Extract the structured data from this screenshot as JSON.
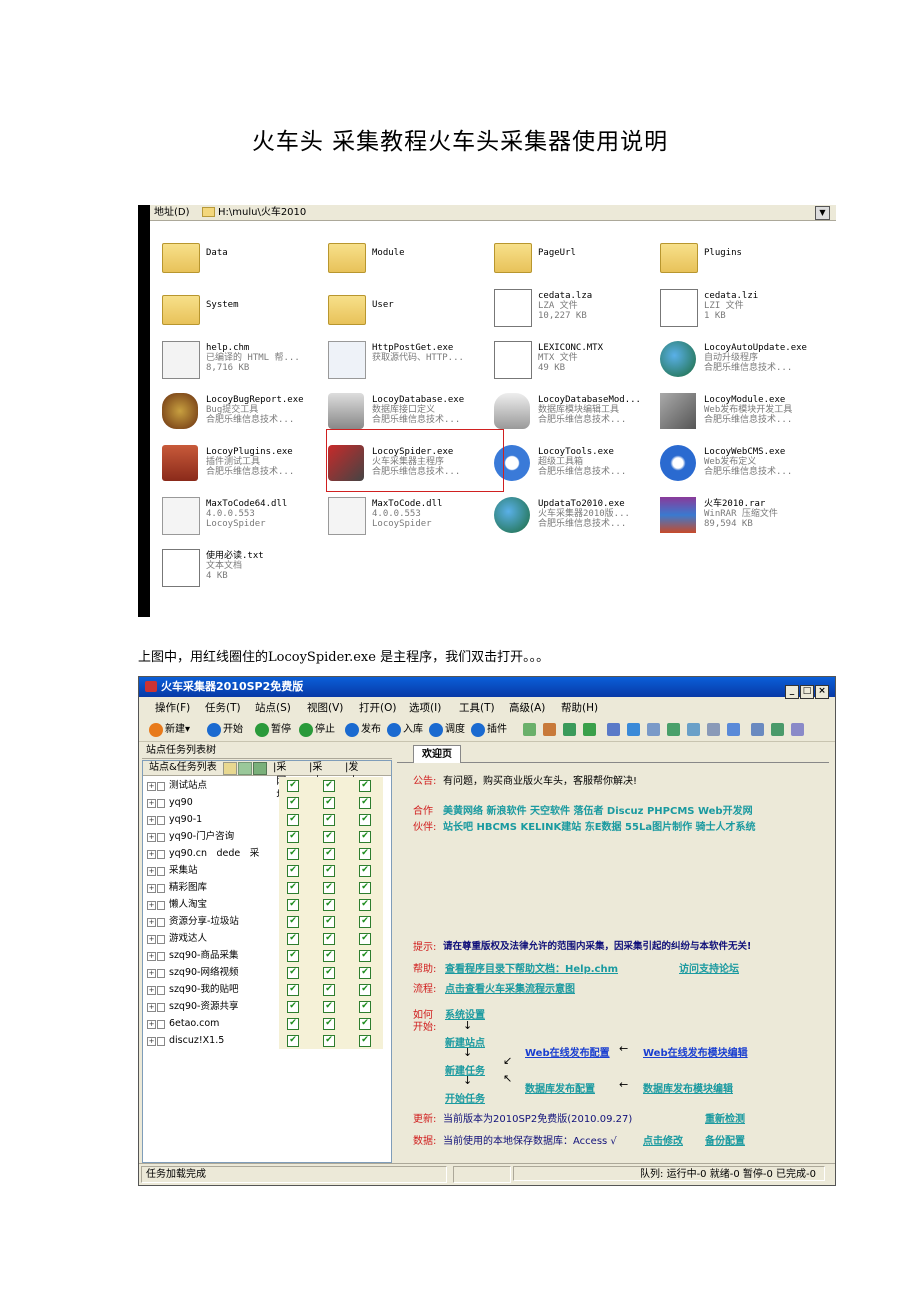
{
  "doc_title": "火车头 采集教程火车头采集器使用说明",
  "explorer": {
    "address_label": "地址(D)",
    "address_path": "H:\\mulu\\火车2010",
    "files": [
      {
        "name": "Data",
        "line2": "",
        "line3": "",
        "icon": "folder-icon"
      },
      {
        "name": "Module",
        "line2": "",
        "line3": "",
        "icon": "folder-icon"
      },
      {
        "name": "PageUrl",
        "line2": "",
        "line3": "",
        "icon": "folder-icon"
      },
      {
        "name": "Plugins",
        "line2": "",
        "line3": "",
        "icon": "folder-icon"
      },
      {
        "name": "System",
        "line2": "",
        "line3": "",
        "icon": "folder-icon"
      },
      {
        "name": "User",
        "line2": "",
        "line3": "",
        "icon": "folder-icon"
      },
      {
        "name": "cedata.lza",
        "line2": "LZA 文件",
        "line3": "10,227 KB",
        "icon": "data-file-icon"
      },
      {
        "name": "cedata.lzi",
        "line2": "LZI 文件",
        "line3": "1 KB",
        "icon": "data-file-icon"
      },
      {
        "name": "help.chm",
        "line2": "已编译的 HTML 帮...",
        "line3": "8,716 KB",
        "icon": "help-file-icon"
      },
      {
        "name": "HttpPostGet.exe",
        "line2": "获取源代码、HTTP...",
        "line3": "",
        "icon": "magnifier-icon"
      },
      {
        "name": "LEXICONC.MTX",
        "line2": "MTX 文件",
        "line3": "49 KB",
        "icon": "data-file-icon"
      },
      {
        "name": "LocoyAutoUpdate.exe",
        "line2": "自动升级程序",
        "line3": "合肥乐维信息技术...",
        "icon": "globe-icon"
      },
      {
        "name": "LocoyBugReport.exe",
        "line2": "Bug提交工具",
        "line3": "合肥乐维信息技术...",
        "icon": "bug-icon"
      },
      {
        "name": "LocoyDatabase.exe",
        "line2": "数据库接口定义",
        "line3": "合肥乐维信息技术...",
        "icon": "sql-icon"
      },
      {
        "name": "LocoyDatabaseMod...",
        "line2": "数据库模块编辑工具",
        "line3": "合肥乐维信息技术...",
        "icon": "database-icon"
      },
      {
        "name": "LocoyModule.exe",
        "line2": "Web发布模块开发工具",
        "line3": "合肥乐维信息技术...",
        "icon": "tools-icon"
      },
      {
        "name": "LocoyPlugins.exe",
        "line2": "插件测试工具",
        "line3": "合肥乐维信息技术...",
        "icon": "plugin-icon"
      },
      {
        "name": "LocoySpider.exe",
        "line2": "火车采集器主程序",
        "line3": "合肥乐维信息技术...",
        "icon": "train-icon"
      },
      {
        "name": "LocoyTools.exe",
        "line2": "超级工具箱",
        "line3": "合肥乐维信息技术...",
        "icon": "gear-icon"
      },
      {
        "name": "LocoyWebCMS.exe",
        "line2": "Web发布定义",
        "line3": "合肥乐维信息技术...",
        "icon": "ie-icon"
      },
      {
        "name": "MaxToCode64.dll",
        "line2": "4.0.0.553",
        "line3": "LocoySpider",
        "icon": "dll-icon"
      },
      {
        "name": "MaxToCode.dll",
        "line2": "4.0.0.553",
        "line3": "LocoySpider",
        "icon": "dll-icon"
      },
      {
        "name": "UpdataTo2010.exe",
        "line2": "火车采集器2010版...",
        "line3": "合肥乐维信息技术...",
        "icon": "globe-icon"
      },
      {
        "name": "火车2010.rar",
        "line2": "WinRAR 压缩文件",
        "line3": "89,594 KB",
        "icon": "winrar-icon"
      },
      {
        "name": "使用必读.txt",
        "line2": "文本文档",
        "line3": "4 KB",
        "icon": "text-file-icon"
      }
    ]
  },
  "description": "上图中，用红线圈住的LocoySpider.exe 是主程序，我们双击打开。。。",
  "app": {
    "title": "火车采集器2010SP2免费版",
    "window_buttons": [
      "_",
      "□",
      "×"
    ],
    "menu": [
      "操作(F)",
      "任务(T)",
      "站点(S)",
      "视图(V)",
      "打开(O)",
      "选项(I)",
      "工具(T)",
      "高级(A)",
      "帮助(H)"
    ],
    "toolbar": [
      "新建",
      "开始",
      "暂停",
      "停止",
      "发布",
      "入库",
      "调度",
      "插件"
    ],
    "left_panel_title": "站点任务列表树",
    "grid_headers": [
      "站点&任务列表",
      "采网址",
      "采内容",
      "发内容"
    ],
    "sites": [
      "测试站点",
      "yq90",
      "yq90-1",
      "yq90-门户咨询",
      "yq90.cn　dede　采",
      "采集站",
      "精彩图库",
      "懒人淘宝",
      "资源分享-垃圾站",
      "游戏达人",
      "szq90-商品采集",
      "szq90-网络视频",
      "szq90-我的贴吧",
      "szq90-资源共享",
      "6etao.com",
      "discuz!X1.5"
    ],
    "tab": "欢迎页",
    "notice_label": "公告:",
    "notice_text": "有问题，购买商业版火车头，客服帮你解决!",
    "partner_label_1": "合作",
    "partner_line_1": "美黄网络  新浪软件  天空软件  落伍者  Discuz  PHPCMS  Web开发网",
    "partner_label_2": "伙伴:",
    "partner_line_2": "站长吧  HBCMS  KELINK建站  东E数据  55La图片制作  骑士人才系统",
    "tip_label": "提示:",
    "tip_text": "请在尊重版权及法律允许的范围内采集，因采集引起的纠纷与本软件无关!",
    "help_label": "帮助:",
    "help_link": "查看程序目录下帮助文档：Help.chm",
    "forum_link": "访问支持论坛",
    "flow_label": "流程:",
    "flow_link": "点击查看火车采集流程示意图",
    "howto_label_1": "如何",
    "howto_label_2": "开始:",
    "step_settings": "系统设置",
    "step_new_site": "新建站点",
    "step_new_task": "新建任务",
    "step_start": "开始任务",
    "web_publish": "Web在线发布配置",
    "web_module": "Web在线发布模块编辑",
    "db_publish": "数据库发布配置",
    "db_module": "数据库发布模块编辑",
    "update_label": "更新:",
    "update_text": "当前版本为2010SP2免费版(2010.09.27)",
    "recheck": "重新检测",
    "data_label": "数据:",
    "data_text": "当前使用的本地保存数据库：Access √",
    "click_modify": "点击修改",
    "backup_config": "备份配置",
    "status_left": "任务加载完成",
    "status_right": "队列: 运行中-0 就绪-0 暂停-0 已完成-0"
  }
}
